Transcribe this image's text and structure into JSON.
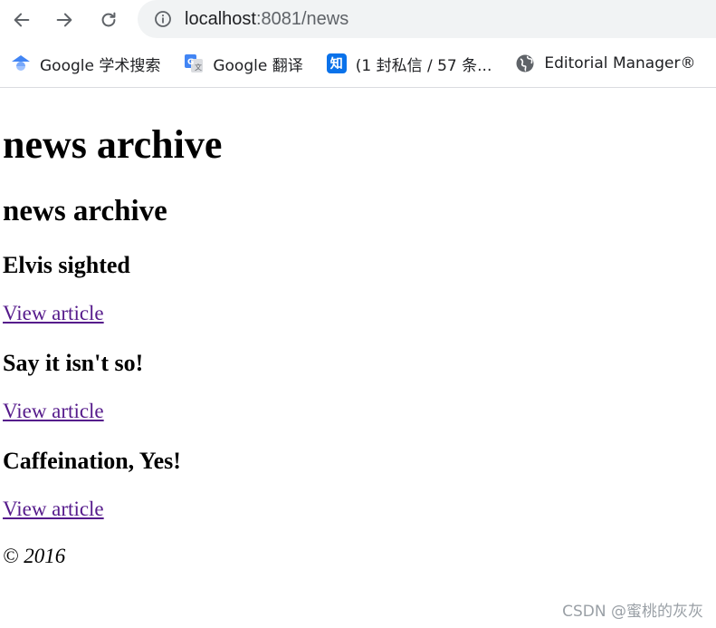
{
  "browser": {
    "url_host": "localhost",
    "url_path": ":8081/news",
    "bookmarks": [
      {
        "label": "Google 学术搜索",
        "icon": "google-scholar-icon"
      },
      {
        "label": "Google 翻译",
        "icon": "google-translate-icon"
      },
      {
        "label": "(1 封私信 / 57 条...",
        "icon": "zhihu-icon",
        "badge": "知"
      },
      {
        "label": "Editorial Manager®",
        "icon": "globe-icon"
      }
    ]
  },
  "page": {
    "h1": "news archive",
    "h2": "news archive",
    "articles": [
      {
        "title": "Elvis sighted",
        "link": "View article"
      },
      {
        "title": "Say it isn't so!",
        "link": "View article"
      },
      {
        "title": "Caffeination, Yes!",
        "link": "View article"
      }
    ],
    "footer": "© 2016"
  },
  "watermark": "CSDN @蜜桃的灰灰",
  "colors": {
    "visited_link": "#551a8b",
    "omnibox_bg": "#f1f3f4"
  }
}
